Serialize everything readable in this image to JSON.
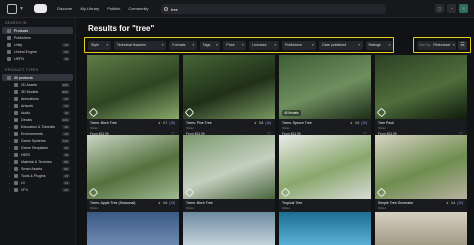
{
  "topbar": {
    "nav": [
      "Discover",
      "My Library",
      "Publish",
      "Community"
    ],
    "search_value": "tree",
    "bell": "●",
    "avatar_letter": "S"
  },
  "sidebar": {
    "search_in_title": "SEARCH IN",
    "search_in": [
      {
        "label": "Products",
        "count": "",
        "selected": true
      },
      {
        "label": "Publishers",
        "count": ""
      },
      {
        "label": "Unity",
        "count": "1K"
      },
      {
        "label": "Unreal Engine",
        "count": "4K"
      },
      {
        "label": "UEFN",
        "count": "35"
      }
    ],
    "types_title": "PRODUCT TYPES",
    "types": [
      {
        "label": "All products",
        "count": "",
        "selected": true
      },
      {
        "label": "2D Assets",
        "count": "40K"
      },
      {
        "label": "3D Models",
        "count": "82K"
      },
      {
        "label": "Animations",
        "count": "1K"
      },
      {
        "label": "Artwork",
        "count": "1K"
      },
      {
        "label": "Audio",
        "count": "15"
      },
      {
        "label": "Decals",
        "count": "32K"
      },
      {
        "label": "Education & Tutorials",
        "count": "1K"
      },
      {
        "label": "Environments",
        "count": "1K"
      },
      {
        "label": "Game Systems",
        "count": "122"
      },
      {
        "label": "Game Templates",
        "count": "50"
      },
      {
        "label": "HDRI",
        "count": "15"
      },
      {
        "label": "Material & Textures",
        "count": "8K"
      },
      {
        "label": "Smart Assets",
        "count": "8K"
      },
      {
        "label": "Tools & Plugins",
        "count": "15"
      },
      {
        "label": "UI",
        "count": "24"
      },
      {
        "label": "VFX",
        "count": "2K"
      }
    ]
  },
  "results_title": "Results for \"tree\"",
  "filters": [
    "Style",
    "Technical features",
    "Formats",
    "Tags",
    "Price",
    "Licenses",
    "Publishers",
    "Date published",
    "Ratings"
  ],
  "sort": {
    "label": "Sort by",
    "value": "Relevance",
    "grid_icon": "☰"
  },
  "cards": [
    {
      "name": "Trees: Birch Tree",
      "seller": "SiKas",
      "price": "From $24.99",
      "stars": "4.7",
      "reviews": "(15)",
      "badge": "",
      "colors": [
        "#5f7d46",
        "#2f4523",
        "#8aa86a"
      ]
    },
    {
      "name": "Trees: Pine Tree",
      "seller": "SiKas",
      "price": "From $24.99",
      "stars": "3.8",
      "reviews": "(16)",
      "badge": "",
      "colors": [
        "#466536",
        "#203018",
        "#7b9862"
      ]
    },
    {
      "name": "Trees: Spruce Tree",
      "seller": "SiKas",
      "price": "From $24.99",
      "stars": "4.5",
      "reviews": "(10)",
      "badge": "45 Models",
      "colors": [
        "#3e5d34",
        "#6f8f5f",
        "#1d2c18"
      ]
    },
    {
      "name": "Tree Pack",
      "seller": "SiKas",
      "price": "From $24.99",
      "stars": "",
      "reviews": "",
      "badge": "",
      "colors": [
        "#2c4024",
        "#4f6e3b",
        "#0f1a0d"
      ]
    },
    {
      "name": "Trees: Apple Tree (Seasonal)",
      "seller": "SiKas",
      "price": "From $24.99",
      "stars": "4.6",
      "reviews": "(13)",
      "badge": "",
      "colors": [
        "#c9d6c5",
        "#55703d",
        "#a0b891"
      ]
    },
    {
      "name": "Trees: Birch Tree",
      "seller": "SiKas",
      "price": "$24.99",
      "stars": "",
      "reviews": "",
      "badge": "",
      "colors": [
        "#7c9a6e",
        "#c4cfc0",
        "#49643a"
      ]
    },
    {
      "name": "Tropical Tree",
      "seller": "SiKas",
      "price": "$9.99",
      "stars": "",
      "reviews": "",
      "badge": "",
      "colors": [
        "#e9ecea",
        "#8aa76d",
        "#d7dbd6"
      ]
    },
    {
      "name": "Simple Tree Generator",
      "seller": "SiKas",
      "price": "$24.99",
      "stars": "4.4",
      "reviews": "(10)",
      "badge": "",
      "colors": [
        "#d9d4c6",
        "#6e8d4e",
        "#b7b0a0"
      ]
    }
  ],
  "partial_cards": [
    {
      "colors": [
        "#3a5a86",
        "#6e8ab0"
      ]
    },
    {
      "colors": [
        "#6d8b9f",
        "#c3d3dc"
      ]
    },
    {
      "colors": [
        "#1d6e93",
        "#5ab0d6"
      ]
    },
    {
      "colors": [
        "#d6cfc0",
        "#a39a86"
      ]
    }
  ]
}
